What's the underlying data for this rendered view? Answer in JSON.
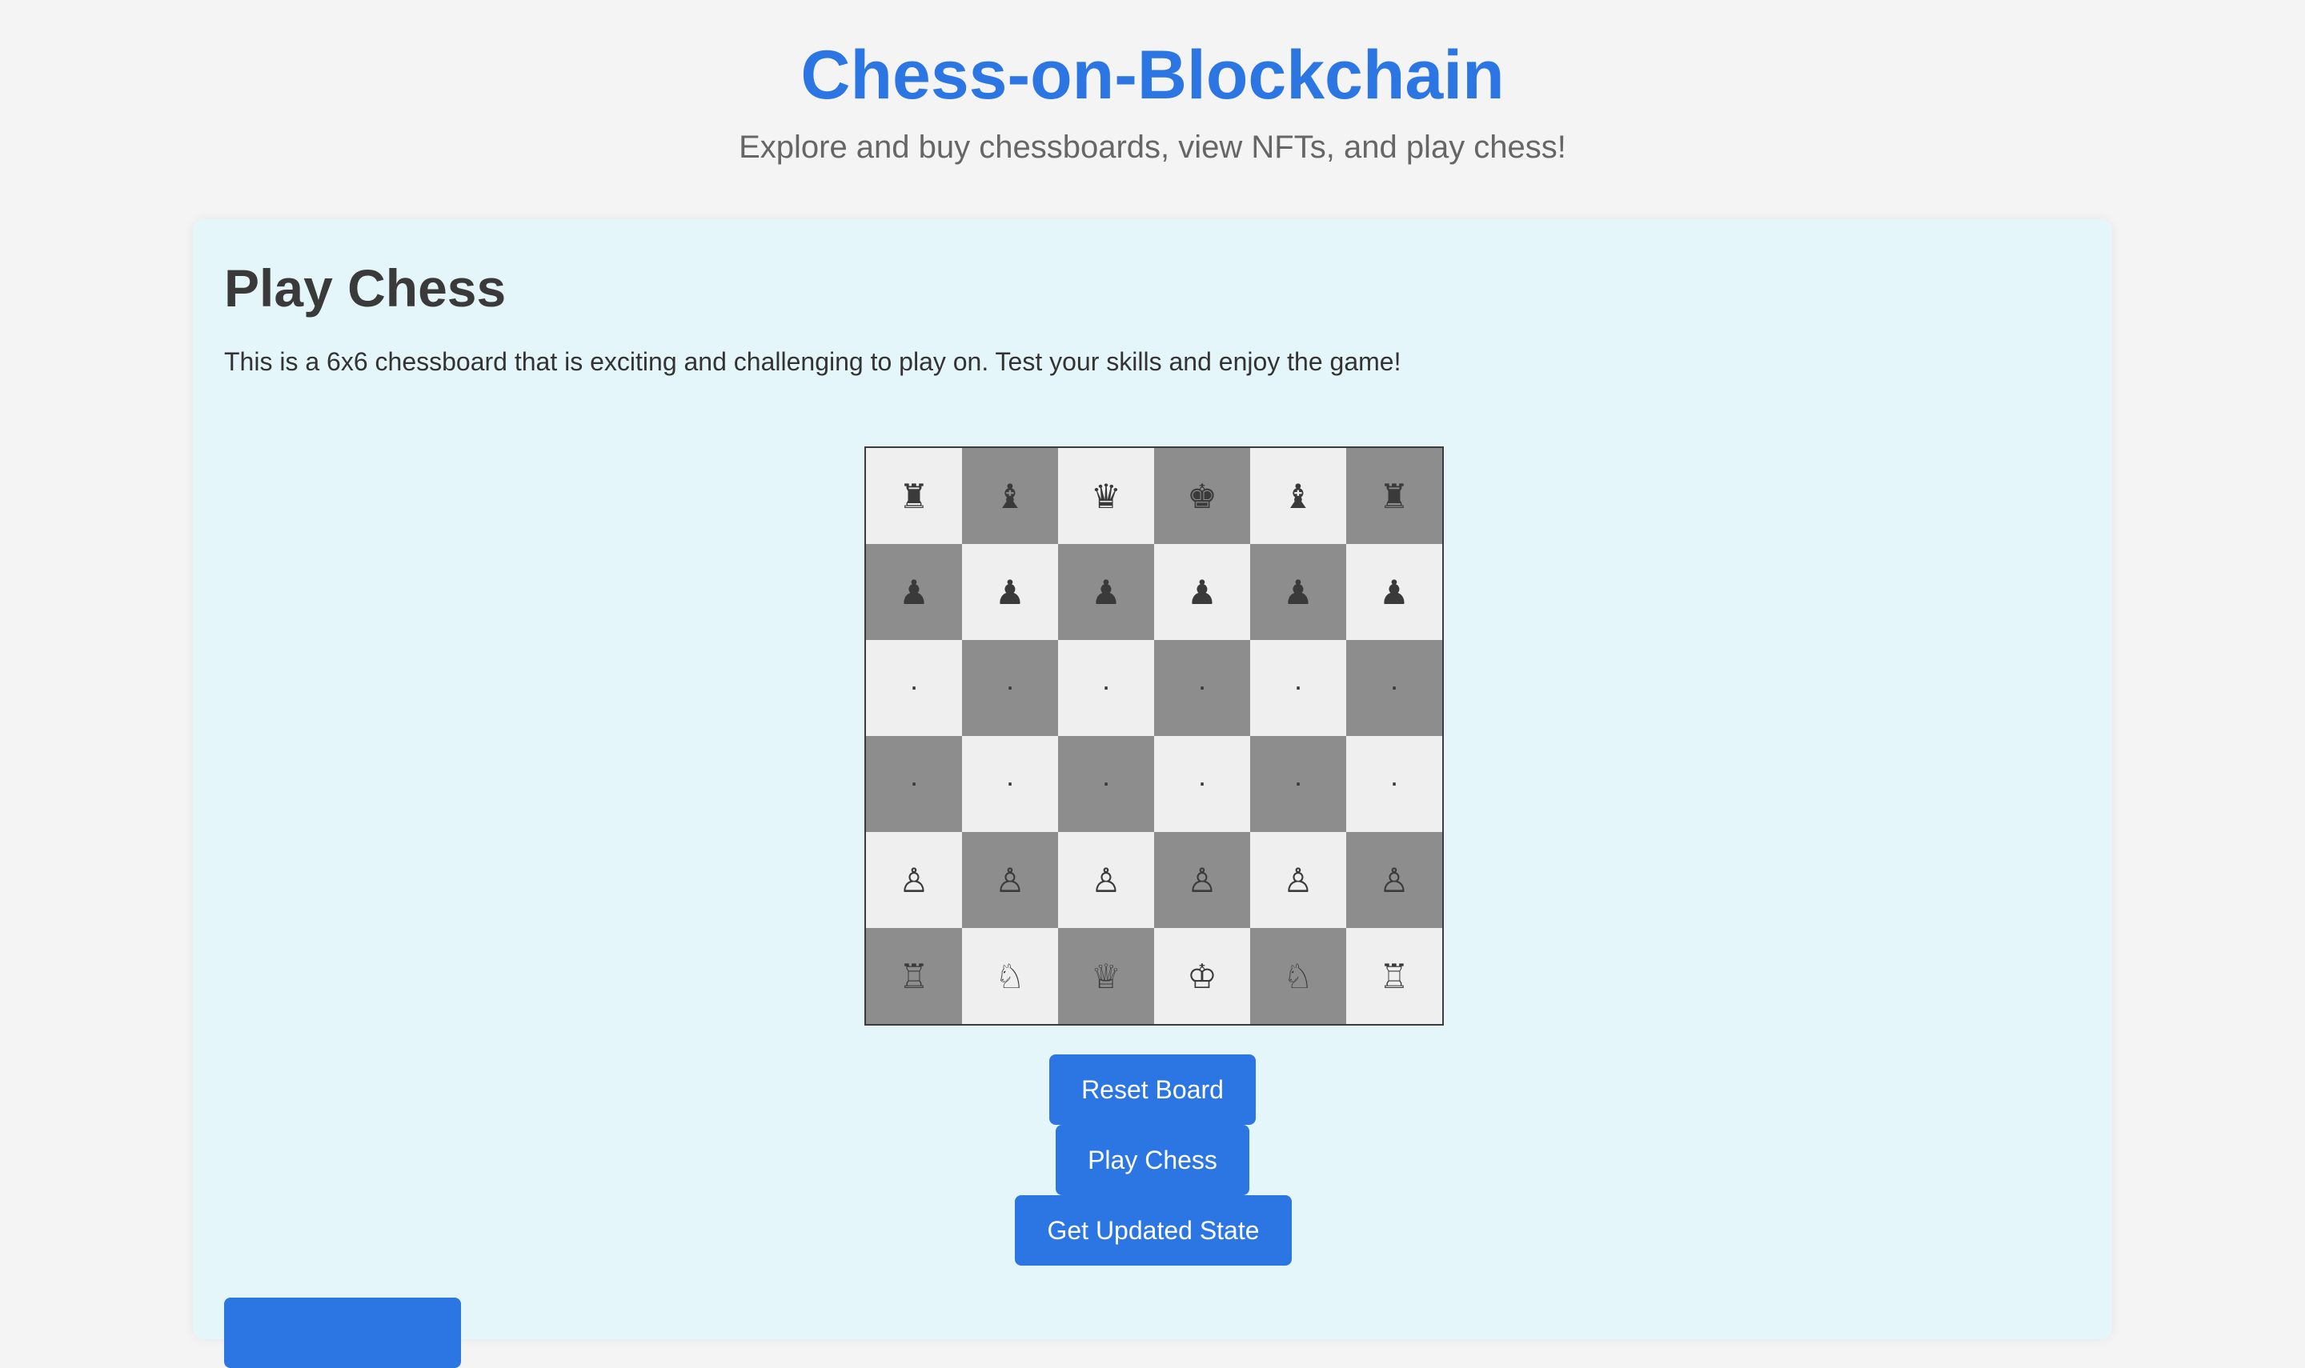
{
  "header": {
    "title": "Chess-on-Blockchain",
    "subtitle": "Explore and buy chessboards, view NFTs, and play chess!"
  },
  "play_section": {
    "title": "Play Chess",
    "description": "This is a 6x6 chessboard that is exciting and challenging to play on. Test your skills and enjoy the game!"
  },
  "board": {
    "size": 6,
    "rows": [
      [
        "♜",
        "♝",
        "♛",
        "♚",
        "♝",
        "♜"
      ],
      [
        "♟",
        "♟",
        "♟",
        "♟",
        "♟",
        "♟"
      ],
      [
        "·",
        "·",
        "·",
        "·",
        "·",
        "·"
      ],
      [
        "·",
        "·",
        "·",
        "·",
        "·",
        "·"
      ],
      [
        "♙",
        "♙",
        "♙",
        "♙",
        "♙",
        "♙"
      ],
      [
        "♖",
        "♘",
        "♕",
        "♔",
        "♘",
        "♖"
      ]
    ]
  },
  "buttons": {
    "reset": "Reset Board",
    "play": "Play Chess",
    "get_state": "Get Updated State",
    "bottom": ""
  },
  "colors": {
    "accent": "#2b76e3",
    "panel_bg": "#e4f6fa",
    "page_bg": "#f4f4f4",
    "light_square": "#efefef",
    "dark_square": "#8d8d8d"
  }
}
